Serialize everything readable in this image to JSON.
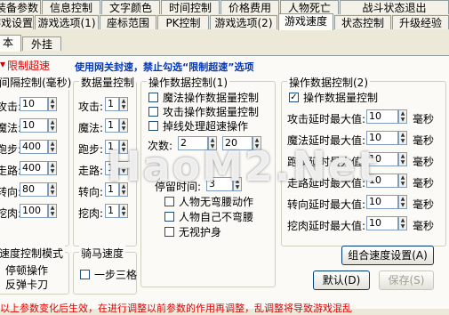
{
  "tabs_row1": [
    "装备参数",
    "信息控制",
    "文字颜色",
    "时间控制",
    "价格费用",
    "人物死亡",
    "战斗状态退出"
  ],
  "tabs_row2": [
    "游戏设置",
    "游戏选项(1)",
    "座标范围",
    "PK控制",
    "游戏选项(2)",
    "游戏速度",
    "状态控制",
    "升级经验"
  ],
  "tabs_row3": [
    "本",
    "外挂"
  ],
  "limit_checkbox_label": "限制超速",
  "notice": "使用网关封速，禁止勾选“限制超速”选项",
  "speed_group": {
    "title": "间隔控制(毫秒)",
    "rows": [
      {
        "label": "攻击:",
        "value": "10"
      },
      {
        "label": "魔法:",
        "value": "10"
      },
      {
        "label": "跑步:",
        "value": "400"
      },
      {
        "label": "走路:",
        "value": "400"
      },
      {
        "label": "转向:",
        "value": "80"
      },
      {
        "label": "挖肉:",
        "value": "100"
      }
    ]
  },
  "data_count_group": {
    "title": "数据量控制",
    "rows": [
      {
        "label": "攻击:",
        "value": "1"
      },
      {
        "label": "魔法:",
        "value": "1"
      },
      {
        "label": "跑步:",
        "value": "1"
      },
      {
        "label": "走路:",
        "value": "1"
      },
      {
        "label": "转向:",
        "value": "1"
      },
      {
        "label": "挖肉:",
        "value": "1"
      }
    ]
  },
  "op_group1": {
    "title": "操作数据控制(1)",
    "checks": [
      {
        "label": "魔法操作数据量控制",
        "checked": false
      },
      {
        "label": "攻击操作数据量控制",
        "checked": false
      },
      {
        "label": "掉线处理超速操作",
        "checked": false
      }
    ],
    "count_label": "次数:",
    "count_value1": "2",
    "count_value2": "20",
    "stay_label": "停留时间:",
    "stay_value": "3",
    "checks2": [
      {
        "label": "人物无弯腰动作",
        "checked": false
      },
      {
        "label": "人物自己不弯腰",
        "checked": false
      },
      {
        "label": "无视护身",
        "checked": false
      }
    ]
  },
  "op_group2": {
    "title": "操作数据控制(2)",
    "main_check": {
      "label": "操作数据量控制",
      "checked": true
    },
    "unit": "毫秒",
    "rows": [
      {
        "label": "攻击延时最大值:",
        "value": "10"
      },
      {
        "label": "魔法延时最大值:",
        "value": "10"
      },
      {
        "label": "跑步延时最大值:",
        "value": "10"
      },
      {
        "label": "走路延时最大值:",
        "value": "10"
      },
      {
        "label": "转向延时最大值:",
        "value": "10"
      },
      {
        "label": "挖肉延时最大值:",
        "value": "10"
      }
    ]
  },
  "speed_mode_group": {
    "title": "速度控制模式",
    "options": [
      "停顿操作",
      "反弹卡刀"
    ]
  },
  "horse_group": {
    "title": "骑马速度",
    "check": {
      "label": "一步三格",
      "checked": false
    }
  },
  "buttons": {
    "combo": "组合速度设置(A)",
    "default": "默认(D)",
    "save": "保存(S)"
  },
  "bottom_text": "以上参数变化后生效，在进行调整以前参数的作用再调整，乱调整将导致游戏混乱",
  "watermark": "HaoM2.Net"
}
